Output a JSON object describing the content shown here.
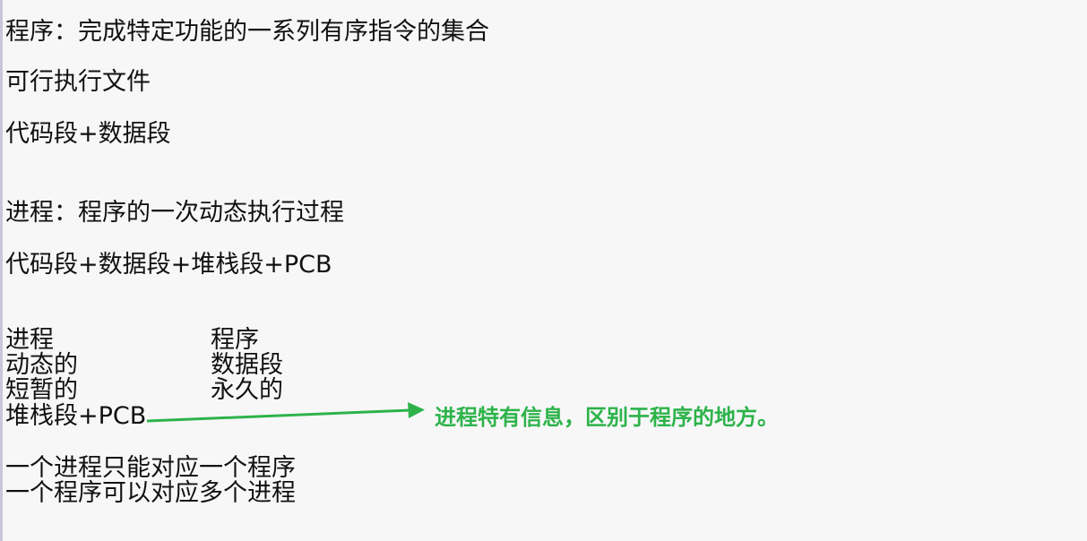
{
  "lines": {
    "program_def": "程序：完成特定功能的一系列有序指令的集合",
    "executable": "可行执行文件",
    "program_parts": "代码段+数据段",
    "process_def": "进程：程序的一次动态执行过程",
    "process_parts": "代码段+数据段+堆栈段+PCB"
  },
  "comparison": {
    "process": [
      "进程",
      "动态的",
      "短暂的",
      "堆栈段+PCB"
    ],
    "program": [
      "程序",
      "数据段",
      "永久的"
    ]
  },
  "annotation": {
    "text": "进程特有信息，区别于程序的地方。",
    "color": "#2db34a"
  },
  "relations": [
    "一个进程只能对应一个程序",
    "一个程序可以对应多个进程"
  ]
}
